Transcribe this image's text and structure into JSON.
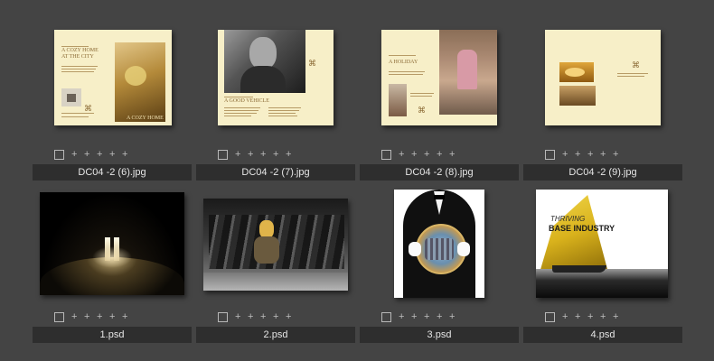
{
  "items": [
    {
      "filename": "DC04 -2 (6).jpg",
      "headline_1": "A COZY HOME",
      "headline_2": "AT THE CITY",
      "caption": "A COZY HOME"
    },
    {
      "filename": "DC04 -2 (7).jpg",
      "headline_1": "A GOOD VEHICLE"
    },
    {
      "filename": "DC04 -2 (8).jpg",
      "headline_1": "A HOLIDAY"
    },
    {
      "filename": "DC04 -2 (9).jpg"
    },
    {
      "filename": "1.psd"
    },
    {
      "filename": "2.psd"
    },
    {
      "filename": "3.psd"
    },
    {
      "filename": "4.psd",
      "poster_line_1": "THRIVING",
      "poster_line_2": "BASE INDUSTRY"
    }
  ],
  "rating_glyph": "+",
  "colors": {
    "background": "#444444",
    "label_bar": "#2e2e2e",
    "label_text": "#e6e6e6",
    "page": "#f7efc8"
  }
}
